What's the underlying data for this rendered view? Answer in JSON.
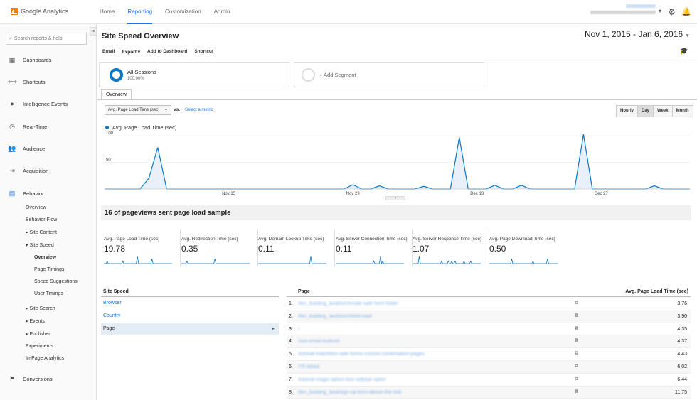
{
  "app": {
    "name": "Google Analytics"
  },
  "topnav": [
    "Home",
    "Reporting",
    "Customization",
    "Admin"
  ],
  "account": {
    "email": "yoko.email@gmail.com",
    "property": "Test Name - http://site.com - Al"
  },
  "sidebar": {
    "search_placeholder": "Search reports & help",
    "items": [
      {
        "label": "Dashboards",
        "icon": "grid-icon"
      },
      {
        "label": "Shortcuts",
        "icon": "shortcut-arrow-icon"
      },
      {
        "label": "Intelligence Events",
        "icon": "lightbulb-icon"
      },
      {
        "label": "Real-Time",
        "icon": "clock-icon"
      },
      {
        "label": "Audience",
        "icon": "people-icon"
      },
      {
        "label": "Acquisition",
        "icon": "acquisition-icon"
      },
      {
        "label": "Behavior",
        "icon": "behavior-icon"
      }
    ],
    "behavior_sub": [
      {
        "label": "Overview"
      },
      {
        "label": "Behavior Flow"
      },
      {
        "label": "▸ Site Content"
      },
      {
        "label": "▾ Site Speed"
      },
      {
        "label": "Overview"
      },
      {
        "label": "Page Timings"
      },
      {
        "label": "Speed Suggestions"
      },
      {
        "label": "User Timings"
      },
      {
        "label": "▸ Site Search"
      },
      {
        "label": "▸ Events"
      },
      {
        "label": "▸ Publisher"
      },
      {
        "label": "Experiments"
      },
      {
        "label": "In-Page Analytics"
      }
    ],
    "conversions": {
      "label": "Conversions",
      "icon": "flag-icon"
    }
  },
  "page": {
    "title": "Site Speed Overview",
    "date_range": "Nov 1, 2015 - Jan 6, 2016",
    "toolbar": [
      "Email",
      "Export ▾",
      "Add to Dashboard",
      "Shortcut"
    ]
  },
  "segments": {
    "active": {
      "title": "All Sessions",
      "sub": "100.00%"
    },
    "add": "+ Add Segment"
  },
  "tab": "Overview",
  "metric_select": "Avg. Page Load Time (sec)",
  "vs": "vs.",
  "select_metric": "Select a metric",
  "granularity": {
    "options": [
      "Hourly",
      "Day",
      "Week",
      "Month"
    ],
    "selected": "Day"
  },
  "legend": "Avg. Page Load Time (sec)",
  "chart_data": {
    "type": "area",
    "series": [
      {
        "name": "Avg. Page Load Time (sec)",
        "values": [
          0,
          0,
          0,
          0,
          0,
          0,
          0,
          0,
          0,
          0,
          0,
          0,
          20,
          78,
          0,
          0,
          0,
          0,
          0,
          0,
          0,
          0,
          0,
          0,
          0,
          0,
          0,
          0,
          0,
          0,
          0,
          0,
          0,
          0,
          0,
          0,
          0,
          0,
          0,
          0,
          0,
          0,
          0,
          0,
          0,
          0,
          0,
          0,
          0,
          0,
          0,
          0,
          0,
          0,
          0,
          0,
          0,
          0,
          0,
          0,
          0,
          0,
          0,
          0,
          0,
          0,
          0,
          0,
          0,
          0,
          0,
          0,
          0,
          0,
          0,
          0,
          0,
          0,
          0,
          0,
          0,
          0,
          0,
          0,
          0,
          0,
          0,
          0,
          0,
          0,
          0,
          0,
          0,
          0,
          0,
          0,
          0,
          0,
          0,
          0,
          0,
          0,
          0,
          0,
          0,
          0,
          0,
          0,
          0,
          0,
          0,
          0,
          0,
          0,
          0,
          0,
          0,
          0,
          0,
          0,
          0,
          0,
          0,
          0,
          0,
          0,
          0,
          0,
          0,
          0,
          0,
          0,
          0,
          0,
          0,
          0,
          0,
          0,
          0,
          0,
          0,
          0,
          0,
          0,
          0,
          0,
          0,
          0,
          0,
          0,
          0,
          0,
          0,
          0,
          0,
          0,
          0,
          0,
          0,
          0,
          0,
          0,
          0,
          0,
          0,
          0,
          0,
          0,
          0,
          0,
          0,
          0,
          0,
          0,
          0,
          0,
          0,
          0,
          0,
          0,
          0,
          0,
          0,
          0,
          0,
          0,
          0,
          0,
          0,
          0,
          0,
          0,
          0,
          0,
          0,
          0,
          0,
          0,
          0,
          0,
          0,
          0,
          0,
          0,
          0,
          0,
          0,
          0,
          0,
          0,
          0,
          0,
          0,
          0,
          0,
          0,
          0,
          0,
          0,
          0,
          0,
          0,
          0,
          0,
          0,
          0,
          0,
          0,
          0,
          0,
          0,
          0,
          0,
          0,
          0,
          0,
          0,
          0,
          0,
          0,
          0,
          0,
          0,
          0,
          0,
          0,
          0,
          0,
          0,
          0,
          0,
          0,
          0,
          0,
          0,
          0,
          0,
          0,
          0,
          0,
          0,
          0,
          0,
          0,
          0,
          0,
          0,
          0,
          0,
          0,
          0,
          0,
          0,
          0,
          0,
          0,
          0,
          0,
          0,
          0,
          0,
          0,
          0,
          0,
          0,
          0,
          0,
          0,
          0,
          0,
          0,
          0,
          0,
          0,
          0,
          0,
          0,
          0,
          0,
          0,
          0,
          0,
          0,
          0,
          0,
          0,
          0,
          0,
          0,
          0,
          0,
          0,
          0,
          0,
          0,
          0,
          0,
          0,
          0,
          0,
          0,
          0,
          0,
          0,
          0,
          0,
          0,
          0,
          0,
          0,
          0,
          0,
          0,
          0,
          0,
          0,
          0,
          0,
          0,
          0,
          0,
          0,
          0,
          0,
          0
        ]
      }
    ],
    "points": [
      {
        "day": "Nov 1",
        "v": 0
      },
      {
        "day": "Nov 5",
        "v": 0
      },
      {
        "day": "Nov 6",
        "v": 20
      },
      {
        "day": "Nov 7",
        "v": 78
      },
      {
        "day": "Nov 8",
        "v": 0
      },
      {
        "day": "Nov 28",
        "v": 0
      },
      {
        "day": "Nov 29",
        "v": 8
      },
      {
        "day": "Nov 30",
        "v": 0
      },
      {
        "day": "Dec 1",
        "v": 0
      },
      {
        "day": "Dec 2",
        "v": 6
      },
      {
        "day": "Dec 3",
        "v": 0
      },
      {
        "day": "Dec 6",
        "v": 0
      },
      {
        "day": "Dec 7",
        "v": 5
      },
      {
        "day": "Dec 8",
        "v": 0
      },
      {
        "day": "Dec 10",
        "v": 0
      },
      {
        "day": "Dec 11",
        "v": 97
      },
      {
        "day": "Dec 12",
        "v": 0
      },
      {
        "day": "Dec 14",
        "v": 0
      },
      {
        "day": "Dec 15",
        "v": 7
      },
      {
        "day": "Dec 16",
        "v": 0
      },
      {
        "day": "Dec 17",
        "v": 0
      },
      {
        "day": "Dec 18",
        "v": 7
      },
      {
        "day": "Dec 19",
        "v": 0
      },
      {
        "day": "Dec 24",
        "v": 0
      },
      {
        "day": "Dec 25",
        "v": 115
      },
      {
        "day": "Dec 26",
        "v": 0
      },
      {
        "day": "Jan 1",
        "v": 0
      },
      {
        "day": "Jan 2",
        "v": 6
      },
      {
        "day": "Jan 3",
        "v": 0
      },
      {
        "day": "Jan 6",
        "v": 0
      }
    ],
    "x_start": "Nov 1",
    "x_end": "Jan 6",
    "ylim": [
      0,
      100
    ],
    "yticks": [
      100,
      50
    ],
    "xticks": [
      "Nov 15",
      "Nov 29",
      "Dec 13",
      "Dec 27"
    ],
    "title": "",
    "xlabel": "",
    "ylabel": "",
    "grid": true
  },
  "sample_text": "16 of pageviews sent page load sample",
  "spark_metrics": [
    {
      "label": "Avg. Page Load Time (sec)",
      "value": "19.78"
    },
    {
      "label": "Avg. Redirection Time (sec)",
      "value": "0.35"
    },
    {
      "label": "Avg. Domain Lookup Time (sec)",
      "value": "0.11"
    },
    {
      "label": "Avg. Server Connection Time (sec)",
      "value": "0.11"
    },
    {
      "label": "Avg. Server Response Time (sec)",
      "value": "1.07"
    },
    {
      "label": "Avg. Page Download Time (sec)",
      "value": "0.50"
    }
  ],
  "dimension": {
    "header": "Site Speed",
    "items": [
      "Browser",
      "Country",
      "Page"
    ],
    "selected": "Page"
  },
  "table": {
    "headers": {
      "page": "Page",
      "value": "Avg. Page Load Time (sec)"
    },
    "rows": [
      {
        "num": "1.",
        "page": "/ten_building_land/torchmale-safe-form-folder",
        "value": "3.76"
      },
      {
        "num": "2.",
        "page": "/ten_building_land/torchfield-road",
        "value": "3.90"
      },
      {
        "num": "3.",
        "page": "/",
        "value": "4.35"
      },
      {
        "num": "4.",
        "page": "/use-email-bulbord",
        "value": "4.37"
      },
      {
        "num": "5.",
        "page": "/tutorial-matchbox-safe-forms-custom-confirmation-pages",
        "value": "4.43"
      },
      {
        "num": "6.",
        "page": "/75-ideas/",
        "value": "6.02"
      },
      {
        "num": "7.",
        "page": "/tutorial-magic-option-box-sidebar-optin/",
        "value": "6.44"
      },
      {
        "num": "8.",
        "page": "/ten_building_land/sign-up-form-above-the-fold",
        "value": "11.75"
      }
    ]
  }
}
